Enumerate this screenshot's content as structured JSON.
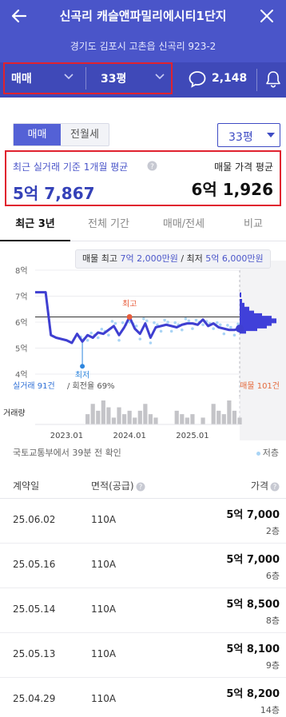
{
  "header": {
    "title": "신곡리 캐슬앤파밀리에시티1단지",
    "address": "경기도 김포시 고촌읍 신곡리 923-2",
    "trade_type": "매매",
    "area": "33평",
    "talk_count": "2,148"
  },
  "filters": {
    "segments": [
      "매매",
      "전월세"
    ],
    "area_dropdown": "33평"
  },
  "price_summary": {
    "avg_label": "최근 실거래 기준 1개월 평균",
    "avg_value": "5억 7,867",
    "listing_label": "매물 가격 평균",
    "listing_value": "6억 1,926"
  },
  "tabs": [
    "최근 3년",
    "전체 기간",
    "매매/전세",
    "비교"
  ],
  "chart": {
    "max_min_prefix": "매물 최고",
    "max_value": "7억 2,000만원",
    "max_min_sep": "/ 최저",
    "min_value": "5억 6,000만원",
    "high_label": "최고",
    "low_label": "최저",
    "trade_count": "실거래 91건",
    "turnover": "/ 회전율 69%",
    "listing_count": "매물 101건",
    "volume_label": "거래량",
    "colors": {
      "line": "#3f3fd1",
      "high": "#e85d3c",
      "low": "#2e86de",
      "scatter": "#a9d4f5",
      "listing": "#4040d9"
    }
  },
  "chart_data": {
    "type": "line",
    "x_ticks": [
      "2023.01",
      "2024.01",
      "2025.01"
    ],
    "y_ticks": [
      "8억",
      "7억",
      "6억",
      "5억",
      "4억"
    ],
    "ylim": [
      4,
      8
    ],
    "y_unit": "억",
    "series": [
      {
        "x": [
          0,
          2,
          3,
          4,
          5,
          6,
          7,
          8,
          9,
          10,
          11,
          12,
          13,
          14,
          15,
          16,
          17,
          18,
          19,
          20,
          21,
          22,
          23,
          24,
          25,
          26,
          27,
          28,
          29,
          30,
          31,
          32,
          33,
          34,
          35,
          36,
          37,
          38,
          39
        ],
        "values": [
          7.15,
          7.15,
          5.5,
          5.4,
          5.35,
          5.3,
          5.2,
          5.55,
          5.25,
          5.5,
          5.4,
          5.6,
          5.55,
          5.7,
          5.85,
          5.5,
          5.8,
          6.2,
          5.75,
          5.55,
          5.95,
          5.4,
          5.8,
          5.85,
          5.9,
          5.85,
          5.8,
          5.9,
          5.95,
          5.95,
          5.9,
          6.1,
          5.85,
          5.95,
          5.8,
          5.75,
          5.7,
          5.7,
          5.75
        ]
      }
    ],
    "reference_line": 6.2,
    "high_point": {
      "x": 18,
      "value": 6.2
    },
    "low_point": {
      "x": 9,
      "value": 4.3
    },
    "volume": [
      0,
      0,
      0,
      0,
      0,
      0,
      0,
      0,
      0,
      0,
      3,
      6,
      4,
      7,
      5,
      2,
      5,
      3,
      4,
      2,
      4,
      6,
      3,
      2,
      0,
      0,
      0,
      4,
      3,
      2,
      3,
      0,
      2,
      0,
      6,
      4,
      3,
      7,
      4,
      2
    ]
  },
  "confirm_text": "국토교통부에서 39분 전 확인",
  "legend_low": "저층",
  "table": {
    "headers": [
      "계약일",
      "면적(공급)",
      "가격"
    ],
    "rows": [
      {
        "date": "25.06.02",
        "area": "110A",
        "price": "5억 7,000",
        "floor": "2층"
      },
      {
        "date": "25.05.16",
        "area": "110A",
        "price": "5억 7,000",
        "floor": "6층"
      },
      {
        "date": "25.05.14",
        "area": "110A",
        "price": "5억 8,500",
        "floor": "8층"
      },
      {
        "date": "25.05.13",
        "area": "110A",
        "price": "5억 8,100",
        "floor": "9층"
      },
      {
        "date": "25.04.29",
        "area": "110A",
        "price": "5억 8,200",
        "floor": "14층"
      }
    ]
  }
}
